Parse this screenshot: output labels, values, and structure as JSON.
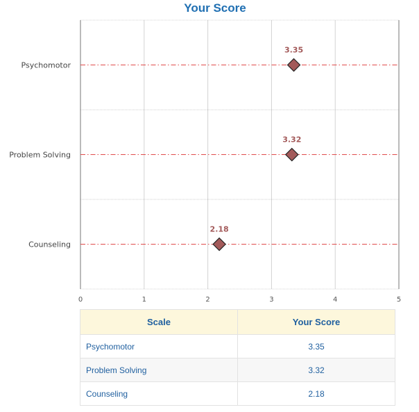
{
  "chart_data": {
    "type": "scatter",
    "title": "Your Score",
    "categories": [
      "Psychomotor",
      "Problem Solving",
      "Counseling"
    ],
    "values": [
      3.35,
      3.32,
      2.18
    ],
    "data_labels": [
      "3.35",
      "3.32",
      "2.18"
    ],
    "x_ticks": [
      "0",
      "1",
      "2",
      "3",
      "4",
      "5"
    ],
    "xlim": [
      0,
      5
    ],
    "marker": "diamond",
    "marker_color": "#a35a5a",
    "label_color": "#a35a5a",
    "reference_line_color": "#e04b4b",
    "reference_line_style": "dash-dot",
    "grid": true
  },
  "table": {
    "headers": [
      "Scale",
      "Your Score"
    ],
    "rows": [
      {
        "scale": "Psychomotor",
        "score": "3.35"
      },
      {
        "scale": "Problem Solving",
        "score": "3.32"
      },
      {
        "scale": "Counseling",
        "score": "2.18"
      }
    ]
  }
}
